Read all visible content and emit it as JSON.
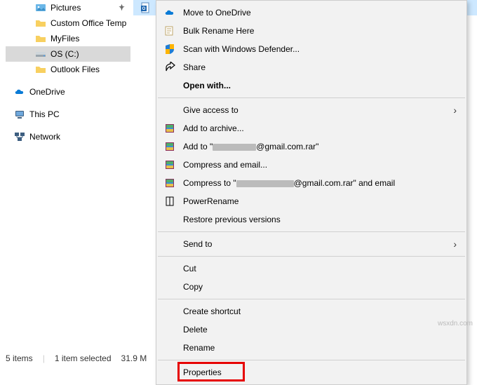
{
  "nav": {
    "items": [
      {
        "label": "Pictures",
        "icon": "pictures",
        "pinned": true,
        "indent": 2
      },
      {
        "label": "Custom Office Temp",
        "icon": "folder",
        "pinned": false,
        "indent": 2
      },
      {
        "label": "MyFiles",
        "icon": "folder",
        "pinned": false,
        "indent": 2
      },
      {
        "label": "OS (C:)",
        "icon": "drive",
        "pinned": false,
        "indent": 2,
        "selected": true
      },
      {
        "label": "Outlook Files",
        "icon": "folder",
        "pinned": false,
        "indent": 2
      }
    ],
    "sections": [
      {
        "label": "OneDrive",
        "icon": "onedrive"
      },
      {
        "label": "This PC",
        "icon": "thispc"
      },
      {
        "label": "Network",
        "icon": "network"
      }
    ]
  },
  "context_menu": {
    "items": [
      {
        "label": "Move to OneDrive",
        "icon": "onedrive"
      },
      {
        "label": "Bulk Rename Here",
        "icon": "rename"
      },
      {
        "label": "Scan with Windows Defender...",
        "icon": "defender"
      },
      {
        "label": "Share",
        "icon": "share"
      },
      {
        "label": "Open with...",
        "bold": true
      },
      {
        "sep": true
      },
      {
        "label": "Give access to",
        "submenu": true
      },
      {
        "label": "Add to archive...",
        "icon": "rar"
      },
      {
        "label": "Add to \"",
        "redact_w": 62,
        "suffix": "@gmail.com.rar\"",
        "icon": "rar"
      },
      {
        "label": "Compress and email...",
        "icon": "rar"
      },
      {
        "label": "Compress to \"",
        "redact_w": 82,
        "suffix": "@gmail.com.rar\" and email",
        "icon": "rar"
      },
      {
        "label": "PowerRename",
        "icon": "power-rename"
      },
      {
        "label": "Restore previous versions"
      },
      {
        "sep": true
      },
      {
        "label": "Send to",
        "submenu": true
      },
      {
        "sep": true
      },
      {
        "label": "Cut"
      },
      {
        "label": "Copy"
      },
      {
        "sep": true
      },
      {
        "label": "Create shortcut"
      },
      {
        "label": "Delete"
      },
      {
        "label": "Rename"
      },
      {
        "sep": true
      },
      {
        "label": "Properties",
        "highlight": true
      }
    ]
  },
  "status": {
    "items_count": "5 items",
    "selected": "1 item selected",
    "size": "31.9 M"
  },
  "watermark": "wsxdn.com"
}
